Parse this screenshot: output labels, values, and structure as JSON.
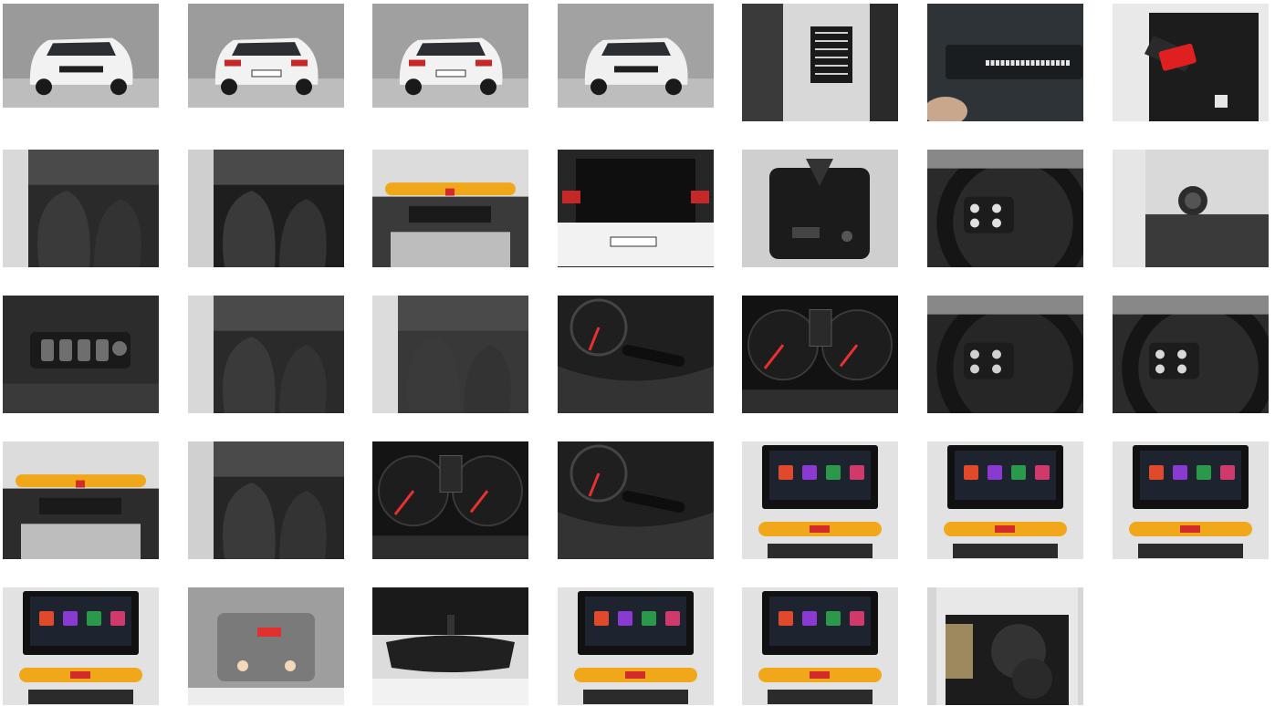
{
  "gallery": {
    "columns": 7,
    "photos": [
      {
        "name": "exterior-front-three-quarter",
        "kind": "car-front",
        "bg": "#9a9a9a",
        "accent": "#f2f2f2",
        "tall": false
      },
      {
        "name": "exterior-rear-three-quarter",
        "kind": "car-rear",
        "bg": "#9c9c9c",
        "accent": "#f2f2f2",
        "tall": false
      },
      {
        "name": "exterior-rear",
        "kind": "car-rear",
        "bg": "#a0a0a0",
        "accent": "#f2f2f2",
        "tall": false
      },
      {
        "name": "exterior-front-side",
        "kind": "car-front",
        "bg": "#a2a2a2",
        "accent": "#f0f0f0",
        "tall": false
      },
      {
        "name": "door-pillar-label",
        "kind": "label",
        "bg": "#d8d8d8",
        "accent": "#1a1a1a",
        "tall": true
      },
      {
        "name": "vin-plate",
        "kind": "vin",
        "bg": "#2e3338",
        "accent": "#e6e6e6",
        "tall": true
      },
      {
        "name": "keys-and-manual",
        "kind": "keys",
        "bg": "#e9e9e9",
        "accent": "#e02020",
        "tall": true
      },
      {
        "name": "front-cabin-driver-door",
        "kind": "interior",
        "bg": "#2a2a2a",
        "accent": "#d9d9d9",
        "tall": true
      },
      {
        "name": "rear-seats-door-open",
        "kind": "interior",
        "bg": "#1e1e1e",
        "accent": "#cfcfcf",
        "tall": true
      },
      {
        "name": "dashboard-overview",
        "kind": "dash",
        "bg": "#3a3a3a",
        "accent": "#f0a81a",
        "tall": true
      },
      {
        "name": "open-trunk",
        "kind": "trunk",
        "bg": "#262626",
        "accent": "#f2f2f2",
        "tall": true
      },
      {
        "name": "spare-wheel-well",
        "kind": "spare",
        "bg": "#cfcfcf",
        "accent": "#222222",
        "tall": true
      },
      {
        "name": "steering-wheel-buttons",
        "kind": "wheel",
        "bg": "#2a2a2a",
        "accent": "#e0e0e0",
        "tall": true
      },
      {
        "name": "light-switch",
        "kind": "switch",
        "bg": "#3a3a3a",
        "accent": "#dedede",
        "tall": true
      },
      {
        "name": "window-controls",
        "kind": "buttons",
        "bg": "#2c2c2c",
        "accent": "#6e6e6e",
        "tall": true
      },
      {
        "name": "front-seats-side-view",
        "kind": "interior",
        "bg": "#2a2a2a",
        "accent": "#d8d8d8",
        "tall": true
      },
      {
        "name": "driver-door-open",
        "kind": "interior",
        "bg": "#383838",
        "accent": "#dcdcdc",
        "tall": true
      },
      {
        "name": "wiper-stalk",
        "kind": "stalk",
        "bg": "#1f1f1f",
        "accent": "#d8d8d8",
        "tall": true
      },
      {
        "name": "instrument-cluster",
        "kind": "gauges",
        "bg": "#121212",
        "accent": "#e83030",
        "tall": true
      },
      {
        "name": "steering-wheel-front",
        "kind": "wheel",
        "bg": "#262626",
        "accent": "#d0d0d0",
        "tall": true
      },
      {
        "name": "steering-wheel-right-buttons",
        "kind": "wheel",
        "bg": "#2b2b2b",
        "accent": "#d8d8d8",
        "tall": true
      },
      {
        "name": "climate-controls",
        "kind": "dash",
        "bg": "#2c2c2c",
        "accent": "#f0a81a",
        "tall": true
      },
      {
        "name": "gear-shifter",
        "kind": "interior",
        "bg": "#262626",
        "accent": "#d0d0d0",
        "tall": true
      },
      {
        "name": "speedometer-and-tachometer",
        "kind": "gauges",
        "bg": "#141414",
        "accent": "#e83030",
        "tall": true
      },
      {
        "name": "indicator-stalk",
        "kind": "stalk",
        "bg": "#1f1f1f",
        "accent": "#dcdcdc",
        "tall": true
      },
      {
        "name": "infotainment-screen-1",
        "kind": "screen",
        "bg": "#2e2e2e",
        "accent": "#f0a81a",
        "tall": true
      },
      {
        "name": "infotainment-screen-2",
        "kind": "screen",
        "bg": "#2e2e2e",
        "accent": "#f0a81a",
        "tall": true
      },
      {
        "name": "infotainment-screen-3",
        "kind": "screen",
        "bg": "#2e2e2e",
        "accent": "#f0a81a",
        "tall": true
      },
      {
        "name": "infotainment-screen-4",
        "kind": "screen",
        "bg": "#2c2c2c",
        "accent": "#f0a81a",
        "tall": true
      },
      {
        "name": "roof-console-lights",
        "kind": "roof",
        "bg": "#9e9e9e",
        "accent": "#e03030",
        "tall": true
      },
      {
        "name": "rear-view-mirror",
        "kind": "mirror",
        "bg": "#dcdcdc",
        "accent": "#202020",
        "tall": true
      },
      {
        "name": "infotainment-menu",
        "kind": "screen",
        "bg": "#2e2e2e",
        "accent": "#f0a81a",
        "tall": true
      },
      {
        "name": "infotainment-apps",
        "kind": "screen",
        "bg": "#2e2e2e",
        "accent": "#f0a81a",
        "tall": true
      },
      {
        "name": "trunk-with-spare-tires",
        "kind": "trunk-tires",
        "bg": "#d6d6d6",
        "accent": "#202020",
        "tall": true
      }
    ]
  }
}
